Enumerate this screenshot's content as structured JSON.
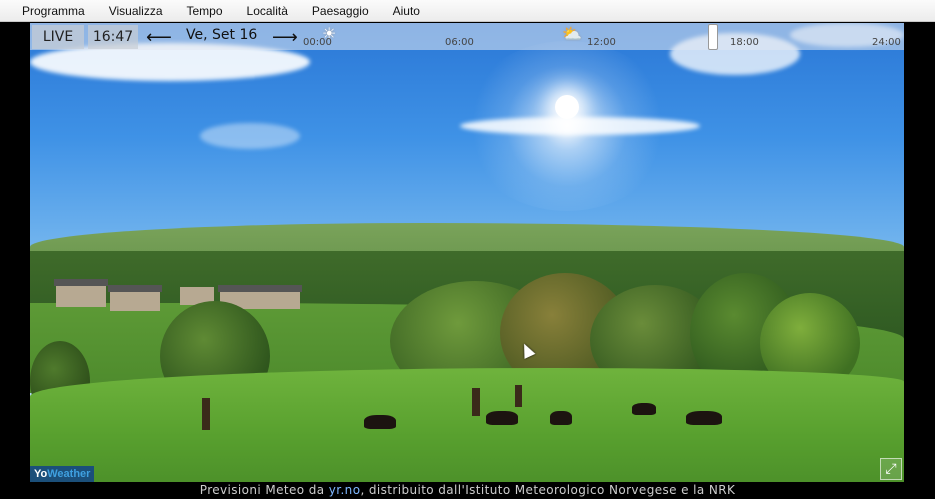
{
  "menu": [
    "Programma",
    "Visualizza",
    "Tempo",
    "Località",
    "Paesaggio",
    "Aiuto"
  ],
  "toolbar": {
    "live_label": "LIVE",
    "time": "16:47",
    "prev_icon": "left-arrow-icon",
    "next_icon": "right-arrow-icon",
    "prev_glyph": "⟵",
    "next_glyph": "⟶",
    "date": "Ve, Set 16"
  },
  "timeline": {
    "ticks": [
      "00:00",
      "06:00",
      "12:00",
      "18:00",
      "24:00"
    ],
    "position_fraction": 0.7,
    "weather_icons": [
      "sun-icon",
      "partly-cloudy-icon"
    ]
  },
  "logo": {
    "part_a": "Yo",
    "part_b": "Weather"
  },
  "footer": {
    "text_before": "Previsioni Meteo da ",
    "link": "yr.no",
    "text_after": ", distribuito dall'Istituto Meteorologico Norvegese e la NRK"
  },
  "colors": {
    "sky_top": "#2a77d6",
    "grass": "#6fb33d",
    "link": "#7fb7ff"
  }
}
